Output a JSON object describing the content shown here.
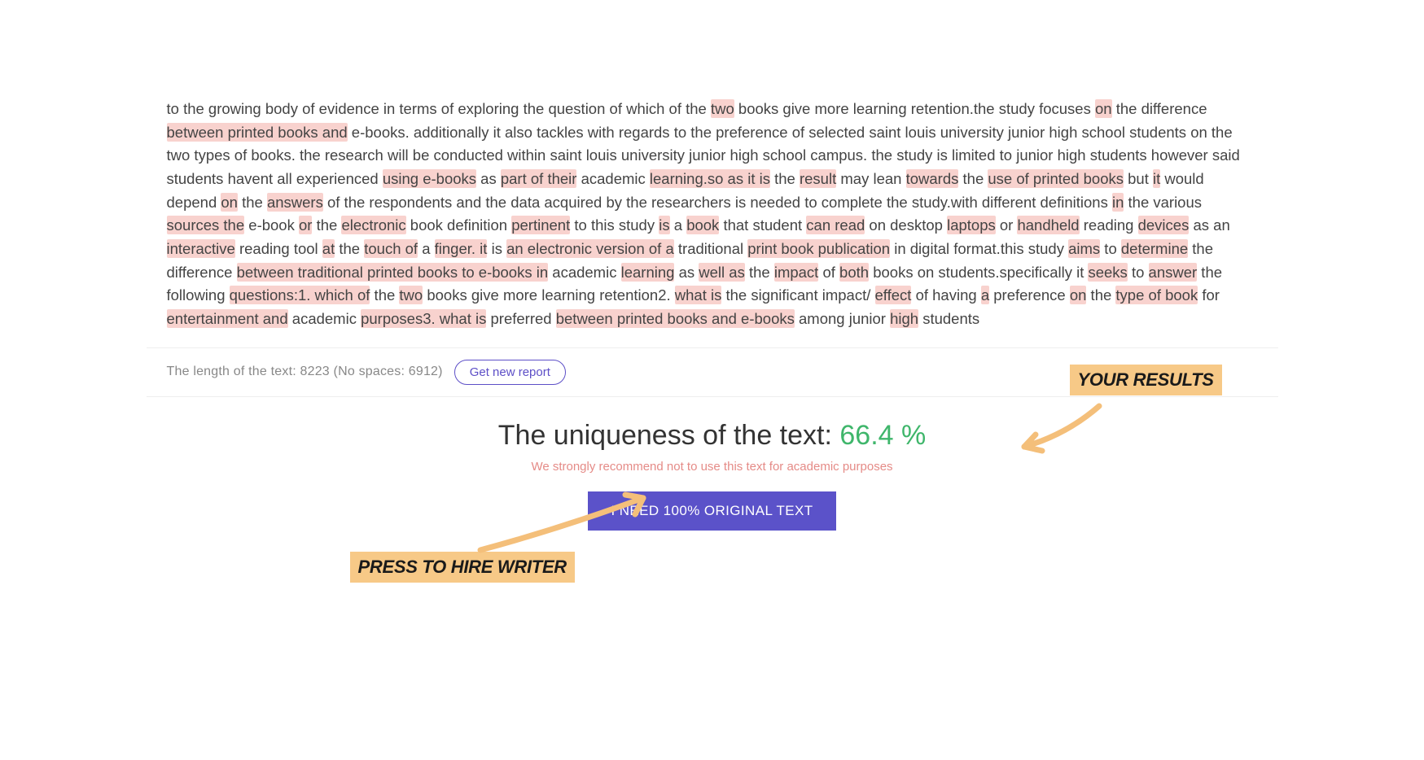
{
  "document": {
    "segments": [
      {
        "t": "to the growing body of evidence in terms of exploring the question of which of the ",
        "h": false
      },
      {
        "t": "two",
        "h": true
      },
      {
        "t": " books give more learning retention.the study focuses ",
        "h": false
      },
      {
        "t": "on",
        "h": true
      },
      {
        "t": " the difference ",
        "h": false
      },
      {
        "t": "between printed books and",
        "h": true
      },
      {
        "t": " e-books. additionally it also tackles with regards to the preference of selected saint louis university junior high school students on the two types of books. the research will be conducted within saint louis university junior high school campus. the study is limited to junior high students however said students havent all experienced ",
        "h": false
      },
      {
        "t": "using e-books",
        "h": true
      },
      {
        "t": " as ",
        "h": false
      },
      {
        "t": "part of their",
        "h": true
      },
      {
        "t": " academic ",
        "h": false
      },
      {
        "t": "learning.so as it is",
        "h": true
      },
      {
        "t": " the ",
        "h": false
      },
      {
        "t": "result",
        "h": true
      },
      {
        "t": " may lean ",
        "h": false
      },
      {
        "t": "towards",
        "h": true
      },
      {
        "t": " the ",
        "h": false
      },
      {
        "t": "use of printed books",
        "h": true
      },
      {
        "t": " but ",
        "h": false
      },
      {
        "t": "it",
        "h": true
      },
      {
        "t": " would depend ",
        "h": false
      },
      {
        "t": "on",
        "h": true
      },
      {
        "t": " the ",
        "h": false
      },
      {
        "t": "answers",
        "h": true
      },
      {
        "t": " of the respondents and the data acquired by the researchers is needed to complete the study.with different definitions ",
        "h": false
      },
      {
        "t": "in",
        "h": true
      },
      {
        "t": " the various ",
        "h": false
      },
      {
        "t": "sources the",
        "h": true
      },
      {
        "t": " e-book ",
        "h": false
      },
      {
        "t": "or",
        "h": true
      },
      {
        "t": " the ",
        "h": false
      },
      {
        "t": "electronic",
        "h": true
      },
      {
        "t": " book definition ",
        "h": false
      },
      {
        "t": "pertinent",
        "h": true
      },
      {
        "t": " to this study ",
        "h": false
      },
      {
        "t": "is",
        "h": true
      },
      {
        "t": " a ",
        "h": false
      },
      {
        "t": "book",
        "h": true
      },
      {
        "t": " that student ",
        "h": false
      },
      {
        "t": "can read",
        "h": true
      },
      {
        "t": " on desktop ",
        "h": false
      },
      {
        "t": "laptops",
        "h": true
      },
      {
        "t": " or ",
        "h": false
      },
      {
        "t": "handheld",
        "h": true
      },
      {
        "t": " reading ",
        "h": false
      },
      {
        "t": "devices",
        "h": true
      },
      {
        "t": " as an ",
        "h": false
      },
      {
        "t": "interactive",
        "h": true
      },
      {
        "t": " reading tool ",
        "h": false
      },
      {
        "t": "at",
        "h": true
      },
      {
        "t": " the ",
        "h": false
      },
      {
        "t": "touch of",
        "h": true
      },
      {
        "t": " a ",
        "h": false
      },
      {
        "t": "finger. it",
        "h": true
      },
      {
        "t": " is ",
        "h": false
      },
      {
        "t": "an electronic version of a",
        "h": true
      },
      {
        "t": " traditional ",
        "h": false
      },
      {
        "t": "print book publication",
        "h": true
      },
      {
        "t": " in digital format.this study ",
        "h": false
      },
      {
        "t": "aims",
        "h": true
      },
      {
        "t": " to ",
        "h": false
      },
      {
        "t": "determine",
        "h": true
      },
      {
        "t": " the difference ",
        "h": false
      },
      {
        "t": "between traditional printed books to e-books in",
        "h": true
      },
      {
        "t": " academic ",
        "h": false
      },
      {
        "t": "learning",
        "h": true
      },
      {
        "t": " as ",
        "h": false
      },
      {
        "t": "well as",
        "h": true
      },
      {
        "t": " the ",
        "h": false
      },
      {
        "t": "impact",
        "h": true
      },
      {
        "t": " of ",
        "h": false
      },
      {
        "t": "both",
        "h": true
      },
      {
        "t": " books on students.specifically it ",
        "h": false
      },
      {
        "t": "seeks",
        "h": true
      },
      {
        "t": " to ",
        "h": false
      },
      {
        "t": "answer",
        "h": true
      },
      {
        "t": " the following ",
        "h": false
      },
      {
        "t": "questions:1. which of",
        "h": true
      },
      {
        "t": " the ",
        "h": false
      },
      {
        "t": "two",
        "h": true
      },
      {
        "t": " books give more learning retention2. ",
        "h": false
      },
      {
        "t": "what is",
        "h": true
      },
      {
        "t": " the significant impact/ ",
        "h": false
      },
      {
        "t": "effect",
        "h": true
      },
      {
        "t": " of having ",
        "h": false
      },
      {
        "t": "a",
        "h": true
      },
      {
        "t": " preference ",
        "h": false
      },
      {
        "t": "on",
        "h": true
      },
      {
        "t": " the ",
        "h": false
      },
      {
        "t": "type of book",
        "h": true
      },
      {
        "t": " for ",
        "h": false
      },
      {
        "t": "entertainment and",
        "h": true
      },
      {
        "t": " academic ",
        "h": false
      },
      {
        "t": "purposes3. what is",
        "h": true
      },
      {
        "t": " preferred ",
        "h": false
      },
      {
        "t": "between printed books and e-books",
        "h": true
      },
      {
        "t": " among junior ",
        "h": false
      },
      {
        "t": "high",
        "h": true
      },
      {
        "t": " students",
        "h": false
      }
    ]
  },
  "info": {
    "length_label": "The length of the text: 8223 (No spaces: 6912)",
    "new_report_label": "Get new report"
  },
  "result": {
    "uniq_prefix": "The uniqueness of the text: ",
    "uniq_value": "66.4 %",
    "warning": "We strongly recommend not to use this text for academic purposes",
    "button_label": "I NEED 100% ORIGINAL TEXT"
  },
  "annotations": {
    "your_results": "YOUR RESULTS",
    "press_to_hire": "PRESS TO HIRE WRITER"
  }
}
